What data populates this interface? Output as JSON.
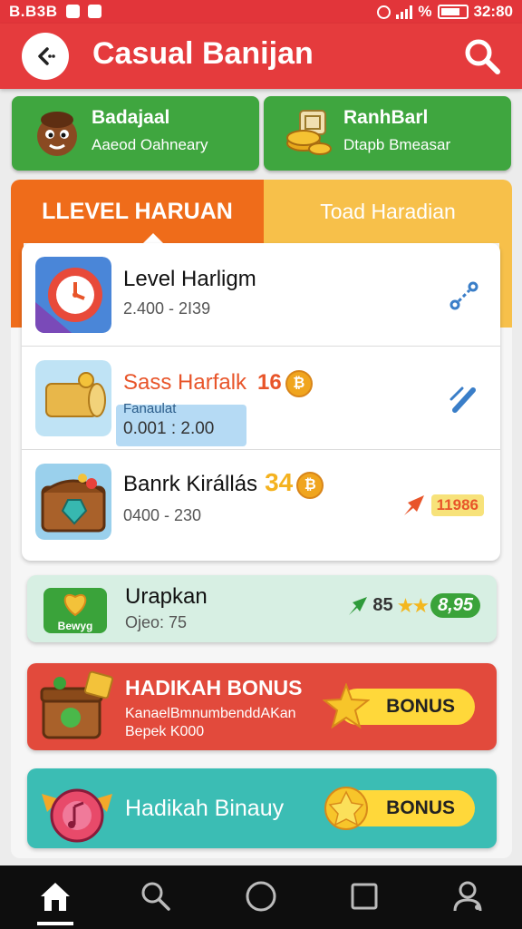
{
  "status_bar": {
    "left_text": "B.B3B",
    "battery": "%",
    "time": "32:80"
  },
  "header": {
    "title": "Casual Banijan"
  },
  "top_cards": [
    {
      "title": "Badajaal",
      "subtitle": "Aaeod Oahneary",
      "icon": "character-icon"
    },
    {
      "title": "RanhBarl",
      "subtitle": "Dtapb Bmeasar",
      "icon": "coin-stack-icon"
    }
  ],
  "tabs": [
    {
      "label": "LLEVEL HARUAN",
      "active": true
    },
    {
      "label": "Toad Haradian",
      "active": false
    }
  ],
  "list_items": [
    {
      "title": "Level Harligm",
      "subtitle": "2.400 - 2I39",
      "icon": "clock-gear-icon",
      "action_icon": "link-icon"
    },
    {
      "title": "Sass Harfalk",
      "number": "16",
      "coin": "₿",
      "highlight_label": "Fanaulat",
      "highlight_value": "0.001 : 2.00",
      "icon": "log-icon",
      "action_icon": "pencil-icon"
    },
    {
      "title": "Banrk Királlás",
      "number": "34",
      "coin": "₿",
      "subtitle": "0400 - 230",
      "points": "11986",
      "icon": "treasure-chest-icon",
      "action_icon": "arrow-icon"
    }
  ],
  "green_card": {
    "title": "Urapkan",
    "subtitle": "Ojeo: 75",
    "stat_number": "85",
    "stat_badge": "8,95",
    "icon_label": "Bewyg"
  },
  "bonus_cards": [
    {
      "title": "HADIKAH BONUS",
      "subtitle_1": "KanaelBmnumbenddAKan",
      "subtitle_2": "Bepek K000",
      "button": "BONUS"
    },
    {
      "title": "Hadikah Binauy",
      "button": "BONUS"
    }
  ],
  "colors": {
    "header_red": "#e53b3d",
    "green": "#3fa63f",
    "tab_orange": "#ef6c1a",
    "tab_yellow": "#f7c04a",
    "bonus_red": "#e24a3c",
    "bonus_teal": "#3bbdb4",
    "bonus_button": "#ffd83a"
  }
}
